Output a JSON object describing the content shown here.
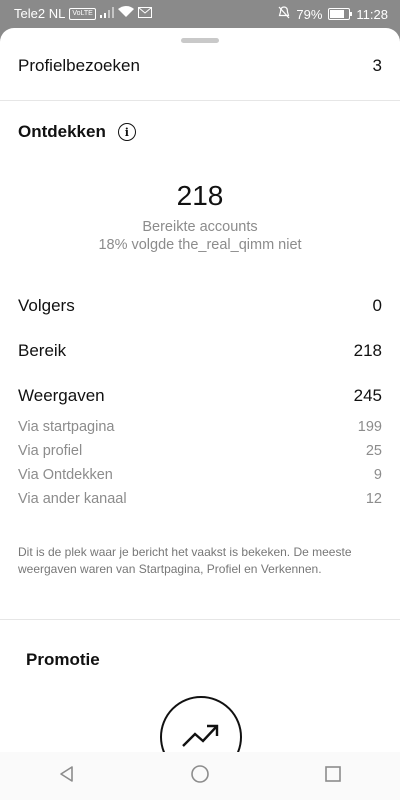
{
  "status": {
    "carrier": "Tele2 NL",
    "volte": "VoLTE",
    "battery": "79%",
    "battery_fraction": 0.79,
    "time": "11:28"
  },
  "profile_visits": {
    "label": "Profielbezoeken",
    "value": "3"
  },
  "discover": {
    "title": "Ontdekken",
    "reach_number": "218",
    "reach_label": "Bereikte accounts",
    "reach_note": "18% volgde the_real_qimm niet"
  },
  "stats": [
    {
      "label": "Volgers",
      "value": "0"
    },
    {
      "label": "Bereik",
      "value": "218"
    },
    {
      "label": "Weergaven",
      "value": "245"
    }
  ],
  "breakdown": [
    {
      "label": "Via startpagina",
      "value": "199"
    },
    {
      "label": "Via profiel",
      "value": "25"
    },
    {
      "label": "Via Ontdekken",
      "value": "9"
    },
    {
      "label": "Via ander kanaal",
      "value": "12"
    }
  ],
  "note": "Dit is de plek waar je bericht het vaakst is bekeken. De meeste weergaven waren van Startpagina, Profiel en Verkennen.",
  "promotion": {
    "title": "Promotie"
  },
  "icons": {
    "info": "info-icon",
    "trend": "trending-up-icon",
    "back": "back-icon",
    "home": "home-icon",
    "recents": "recents-icon"
  }
}
